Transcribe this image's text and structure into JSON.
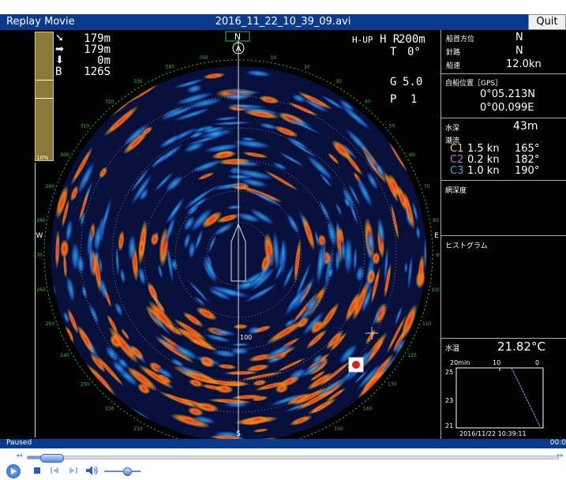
{
  "titlebar": {
    "app_name": "Replay Movie",
    "filename": "2016_11_22_10_39_09.avi",
    "quit_label": "Quit"
  },
  "left_readout": {
    "rows": [
      {
        "icon": "arrow-down-right-icon",
        "value": "179m"
      },
      {
        "icon": "arrow-right-icon",
        "value": "179m"
      },
      {
        "icon": "arrow-down-icon",
        "value": "0m"
      },
      {
        "icon": "B",
        "value": "126S"
      }
    ]
  },
  "gain_scale": {
    "label": "10%",
    "level_marks": [
      0.37,
      0.51
    ]
  },
  "radar": {
    "north_label": "N",
    "bearing_marker": "A",
    "east_label": "E",
    "west_label": "W",
    "south_label": "S",
    "mode": "H-UP",
    "hr_label": "H R",
    "hr_value": "200m",
    "t_label": "T",
    "t_value": "0°",
    "g_label": "G",
    "g_value": "5.0",
    "p_label": "P",
    "p_value": "1",
    "center_depth": "100",
    "outer_ticks": [
      "330",
      "340",
      "350",
      "10",
      "20",
      "30",
      "40",
      "50",
      "60",
      "70",
      "80",
      "90",
      "100",
      "110",
      "120",
      "130",
      "140",
      "150",
      "160",
      "170",
      "180",
      "190",
      "200",
      "210",
      "220",
      "230",
      "240",
      "250",
      "260",
      "270",
      "280",
      "290",
      "300",
      "310",
      "320"
    ],
    "inner_ticks": [
      "300",
      "290",
      "280",
      "260",
      "250",
      "240",
      "230",
      "220",
      "210",
      "200",
      "190",
      "180",
      "170",
      "160",
      "150",
      "140",
      "130",
      "120",
      "110",
      "100",
      "90",
      "80"
    ],
    "colors": {
      "ring": "#3cb84a",
      "echo_hot": "#ff3a1a",
      "echo_warm": "#f8c020",
      "echo_cool": "#1a6ad8",
      "bg": "#000000"
    }
  },
  "right_panel": {
    "heading_label": "船首方位",
    "heading_value": "N",
    "course_label": "針路",
    "course_value": "N",
    "speed_label": "船速",
    "speed_value": "12.0kn",
    "position_label": "自船位置［GPS］",
    "lat": "0°05.213N",
    "lon": "0°00.099E",
    "depth_label": "水深",
    "depth_value": "43m",
    "current_label": "潮流",
    "currents": [
      {
        "label": "C1",
        "speed": "1.5 kn",
        "dir": "165°",
        "color": "#e8d84a"
      },
      {
        "label": "C2",
        "speed": "0.2 kn",
        "dir": "182°",
        "color": "#c070c8"
      },
      {
        "label": "C3",
        "speed": "1.0 kn",
        "dir": "190°",
        "color": "#3fb0c8"
      }
    ],
    "net_depth_label": "網深度",
    "histogram_label": "ヒストグラム",
    "water_temp_label": "水温",
    "water_temp_value": "21.82°C",
    "temp_graph": {
      "x_labels": [
        "20min",
        "10",
        "0"
      ],
      "y_labels": [
        "25",
        "23",
        "21"
      ],
      "timestamp": "2016/11/22 10:39:11"
    }
  },
  "player": {
    "status": "Paused",
    "time": "00:0",
    "seek_progress": 0.045,
    "volume": 0.6
  }
}
